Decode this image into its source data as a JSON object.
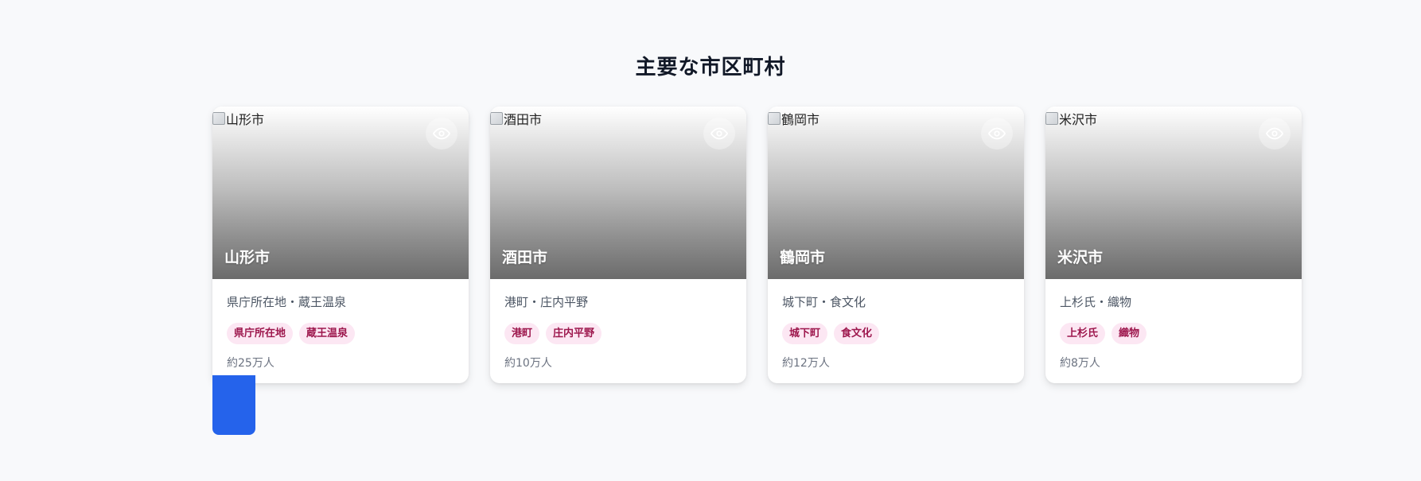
{
  "section": {
    "title": "主要な市区町村"
  },
  "cards": [
    {
      "name": "山形市",
      "image_alt": "山形市",
      "description": "県庁所在地・蔵王温泉",
      "tags": [
        "県庁所在地",
        "蔵王温泉"
      ],
      "population": "約25万人"
    },
    {
      "name": "酒田市",
      "image_alt": "酒田市",
      "description": "港町・庄内平野",
      "tags": [
        "港町",
        "庄内平野"
      ],
      "population": "約10万人"
    },
    {
      "name": "鶴岡市",
      "image_alt": "鶴岡市",
      "description": "城下町・食文化",
      "tags": [
        "城下町",
        "食文化"
      ],
      "population": "約12万人"
    },
    {
      "name": "米沢市",
      "image_alt": "米沢市",
      "description": "上杉氏・織物",
      "tags": [
        "上杉氏",
        "織物"
      ],
      "population": "約8万人"
    }
  ],
  "icons": {
    "view": "eye-icon",
    "image": "broken-image-icon"
  },
  "colors": {
    "accent": "#2563eb",
    "tag_bg": "#fce7f3",
    "tag_text": "#9d174d"
  }
}
